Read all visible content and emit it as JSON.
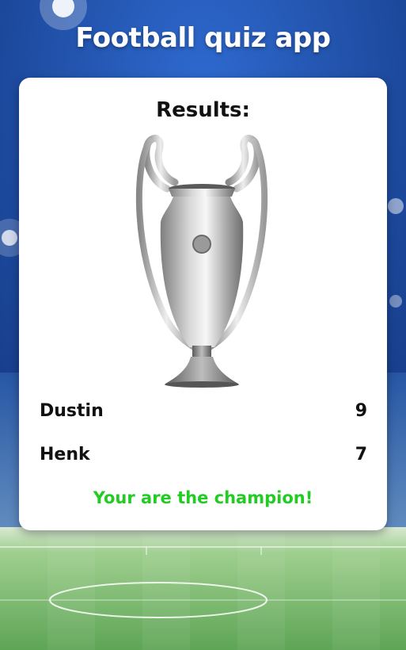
{
  "app": {
    "title": "Football quiz app"
  },
  "results": {
    "heading": "Results:",
    "trophy_icon": "champions-trophy-icon",
    "players": [
      {
        "name": "Dustin",
        "score": "9"
      },
      {
        "name": "Henk",
        "score": "7"
      }
    ],
    "message": "Your are the champion!"
  },
  "colors": {
    "background_blue": "#1e4a9a",
    "card": "#ffffff",
    "text": "#111111",
    "champion_green": "#22cc22",
    "pitch_green": "#5fa85a"
  }
}
